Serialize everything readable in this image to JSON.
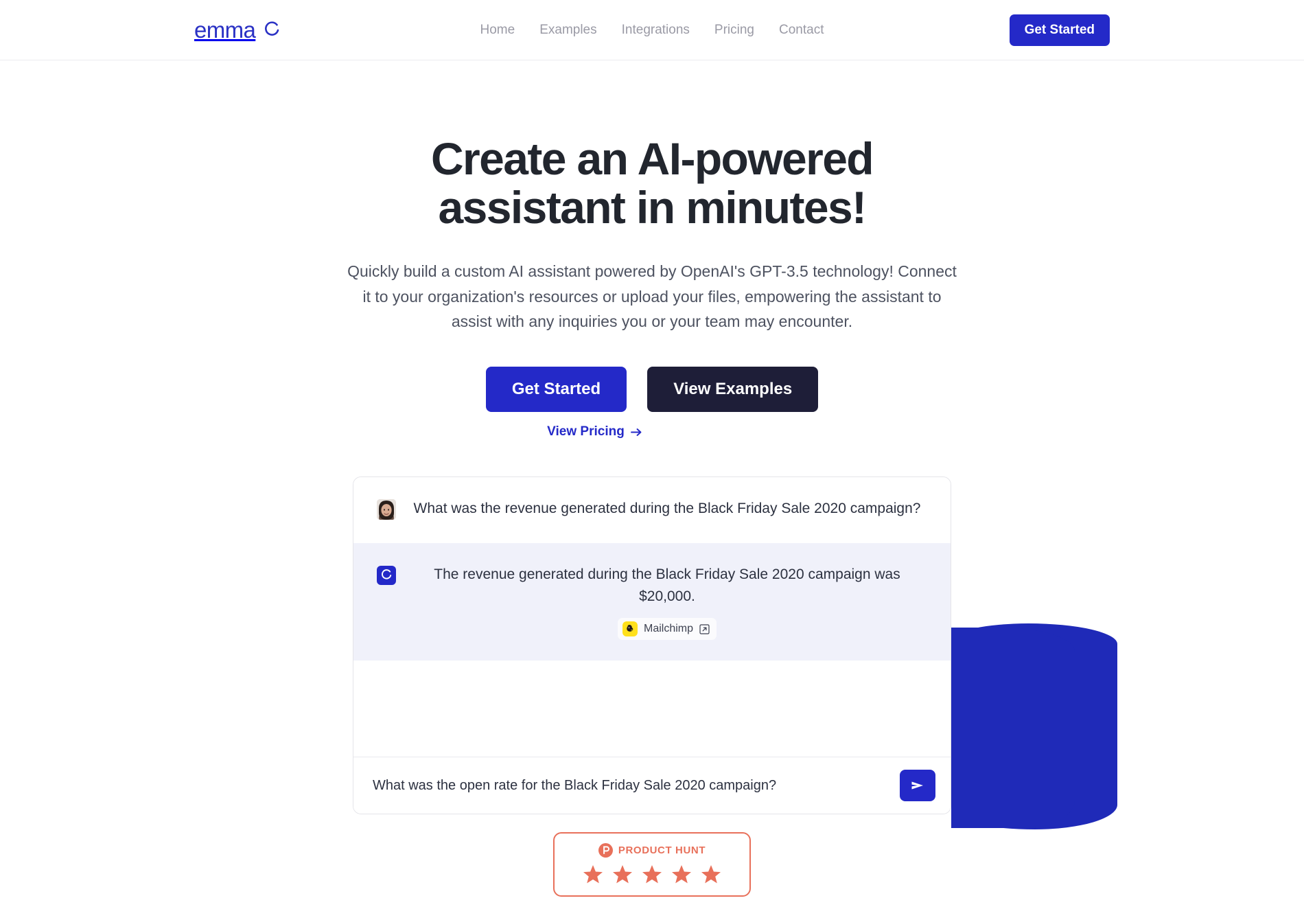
{
  "brand": {
    "name": "emma",
    "mark_icon": "ring-logo-icon",
    "color": "#2a31c4"
  },
  "nav": {
    "items": [
      {
        "label": "Home"
      },
      {
        "label": "Examples"
      },
      {
        "label": "Integrations"
      },
      {
        "label": "Pricing"
      },
      {
        "label": "Contact"
      }
    ],
    "cta_label": "Get Started"
  },
  "hero": {
    "title_line1": "Create an AI-powered",
    "title_line2": "assistant in minutes!",
    "subtitle": "Quickly build a custom AI assistant powered by OpenAI's GPT-3.5 technology! Connect it to your organization's resources or upload your files, empowering the assistant to assist with any inquiries you or your team may encounter.",
    "primary_cta": "Get Started",
    "secondary_cta": "View Examples",
    "pricing_link": "View Pricing",
    "pricing_arrow_icon": "arrow-right-icon"
  },
  "chat": {
    "user_message": {
      "avatar_icon": "user-avatar-photo",
      "text": "What was the revenue generated during the Black Friday Sale 2020 campaign?"
    },
    "bot_message": {
      "avatar_icon": "emma-bot-icon",
      "text": "The revenue generated during the Black Friday Sale 2020 campaign was $20,000.",
      "source": {
        "label": "Mailchimp",
        "logo_icon": "mailchimp-icon",
        "external_icon": "external-link-icon",
        "logo_color": "#ffe01b"
      }
    },
    "input": {
      "value": "What was the open rate for the Black Friday Sale 2020 campaign?",
      "placeholder": "Ask a question...",
      "send_icon": "send-paper-plane-icon"
    }
  },
  "product_hunt": {
    "logo_icon": "product-hunt-icon",
    "label": "PRODUCT HUNT",
    "rating": 5,
    "stars": [
      "star-icon",
      "star-icon",
      "star-icon",
      "star-icon",
      "star-icon"
    ],
    "accent_color": "#e8705a"
  },
  "decor": {
    "blob_color": "#1f2ab8"
  }
}
